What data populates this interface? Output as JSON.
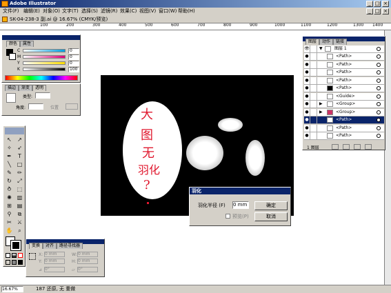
{
  "app": {
    "title": "Adobe Illustrator"
  },
  "menu": [
    "文件(F)",
    "编辑(E)",
    "对象(O)",
    "文字(T)",
    "选择(S)",
    "滤镜(R)",
    "效果(C)",
    "视图(V)",
    "窗口(W)",
    "帮助(H)"
  ],
  "document": {
    "title": "SK-04-238-3 副.ai @ 16.67% (CMYK/预览)"
  },
  "ruler": {
    "ticks": [
      "100",
      "200",
      "300",
      "400",
      "500",
      "600",
      "700",
      "800",
      "900",
      "1000",
      "1100",
      "1200",
      "1300",
      "1400"
    ]
  },
  "color_panel": {
    "tabs": [
      "颜色",
      "属性"
    ],
    "channels": [
      {
        "name": "C",
        "value": "0"
      },
      {
        "name": "M",
        "value": "0"
      },
      {
        "name": "Y",
        "value": "0"
      },
      {
        "name": "K",
        "value": "100"
      }
    ]
  },
  "gradient_panel": {
    "tabs": [
      "描边",
      "渐变",
      "透明"
    ],
    "type_label": "类型:",
    "angle_label": "角度:",
    "angle_value": "",
    "location_label": "位置"
  },
  "layers_panel": {
    "tabs": [
      "图层",
      "动作",
      "链接"
    ],
    "layer_name": "图层 1",
    "items": [
      {
        "name": "<Path>",
        "expand": false,
        "thumb": "#ffffff",
        "selected": false
      },
      {
        "name": "<Path>",
        "expand": false,
        "thumb": "#ffffff",
        "selected": false
      },
      {
        "name": "<Path>",
        "expand": false,
        "thumb": "#ffffff",
        "selected": false
      },
      {
        "name": "<Path>",
        "expand": false,
        "thumb": "#ffffff",
        "selected": false
      },
      {
        "name": "<Path>",
        "expand": false,
        "thumb": "#000000",
        "selected": false
      },
      {
        "name": "<Guide>",
        "expand": false,
        "thumb": "#ffffff",
        "selected": false
      },
      {
        "name": "<Group>",
        "expand": true,
        "thumb": "#ffffff",
        "selected": false
      },
      {
        "name": "<Group>",
        "expand": true,
        "thumb": "#cc3366",
        "selected": false
      },
      {
        "name": "<Path>",
        "expand": false,
        "thumb": "#ffffff",
        "selected": true
      },
      {
        "name": "<Path>",
        "expand": false,
        "thumb": "#ffffff",
        "selected": false
      },
      {
        "name": "<Path>",
        "expand": false,
        "thumb": "#ffffff",
        "selected": false
      }
    ],
    "footer_label": "1 图层"
  },
  "artwork_text": [
    "大",
    "图",
    "无",
    "羽化",
    "?"
  ],
  "feather_dialog": {
    "title": "羽化",
    "radius_label": "羽化半径 (F)",
    "radius_value": "0 mm",
    "preview_label": "预览(P)",
    "ok_label": "确定",
    "cancel_label": "取消"
  },
  "transform_panel": {
    "tabs": [
      "变换",
      "对齐",
      "路径寻找器"
    ],
    "fields": [
      {
        "label": "X:",
        "value": "0 mm"
      },
      {
        "label": "Y:",
        "value": "0 mm"
      },
      {
        "label": "W:",
        "value": "0 mm"
      },
      {
        "label": "H:",
        "value": "0 mm"
      }
    ],
    "rotate_value": "0°",
    "shear_value": "0°"
  },
  "status": {
    "zoom": "16.67%",
    "message": "187 还原, 无 重做"
  },
  "colors": {
    "accent": "#0a246a",
    "chrome": "#d4d0c8",
    "artboard": "#000000",
    "handwriting": "#e0182e"
  }
}
